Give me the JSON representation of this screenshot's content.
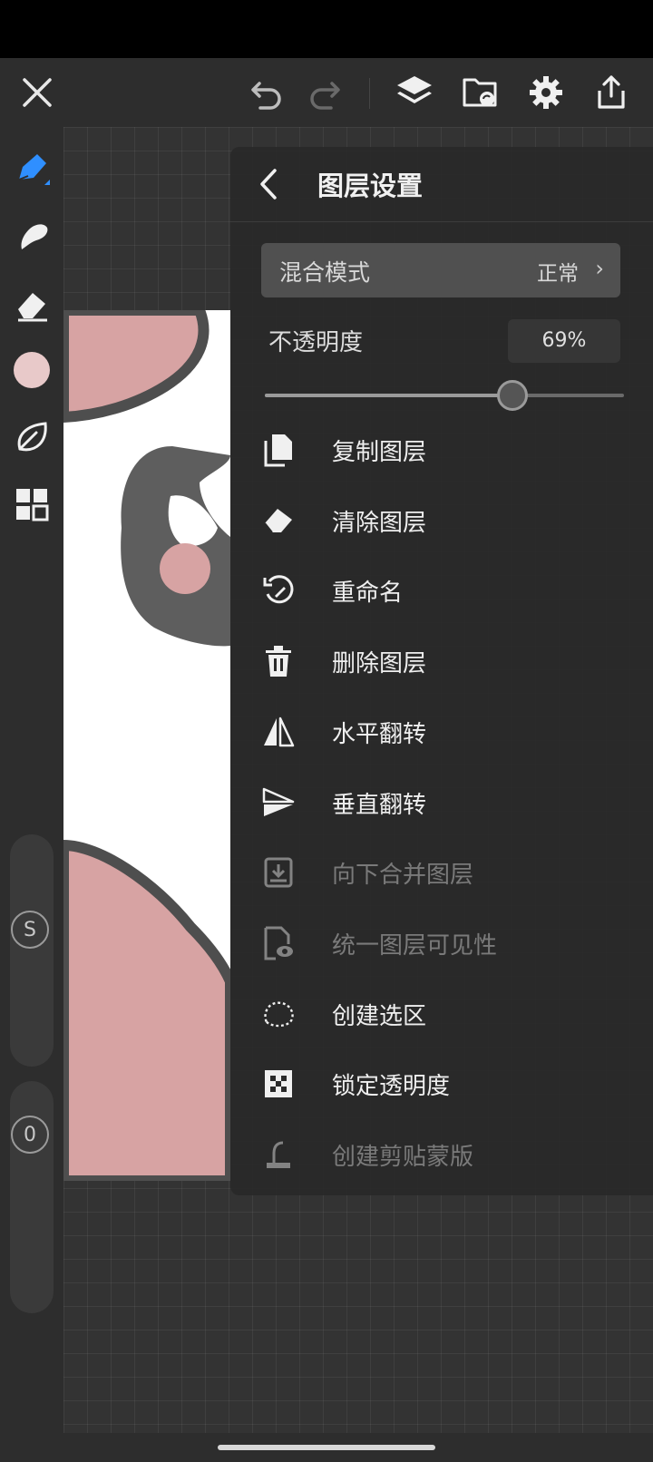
{
  "panel": {
    "title": "图层设置",
    "blend_mode": {
      "label": "混合模式",
      "value": "正常",
      "chevron": "›"
    },
    "opacity": {
      "label": "不透明度",
      "value_text": "69%",
      "value_fraction": 0.69
    },
    "menu": [
      {
        "label": "复制图层",
        "icon": "duplicate-layer-icon",
        "enabled": true
      },
      {
        "label": "清除图层",
        "icon": "eraser-clear-icon",
        "enabled": true
      },
      {
        "label": "重命名",
        "icon": "rename-icon",
        "enabled": true
      },
      {
        "label": "删除图层",
        "icon": "trash-icon",
        "enabled": true
      },
      {
        "label": "水平翻转",
        "icon": "flip-horizontal-icon",
        "enabled": true
      },
      {
        "label": "垂直翻转",
        "icon": "flip-vertical-icon",
        "enabled": true
      },
      {
        "label": "向下合并图层",
        "icon": "merge-down-icon",
        "enabled": false
      },
      {
        "label": "统一图层可见性",
        "icon": "layer-visibility-icon",
        "enabled": false
      },
      {
        "label": "创建选区",
        "icon": "selection-lasso-icon",
        "enabled": true
      },
      {
        "label": "锁定透明度",
        "icon": "lock-transparency-icon",
        "enabled": true
      },
      {
        "label": "创建剪贴蒙版",
        "icon": "clipping-mask-icon",
        "enabled": false
      }
    ]
  },
  "sidebar": {
    "size_badge": "S",
    "opacity_badge": "0"
  },
  "colors": {
    "accent": "#2f8fff",
    "current_color": "#e8c9c9",
    "art_pink": "#d7a3a3",
    "art_gray": "#5a5a5a"
  }
}
